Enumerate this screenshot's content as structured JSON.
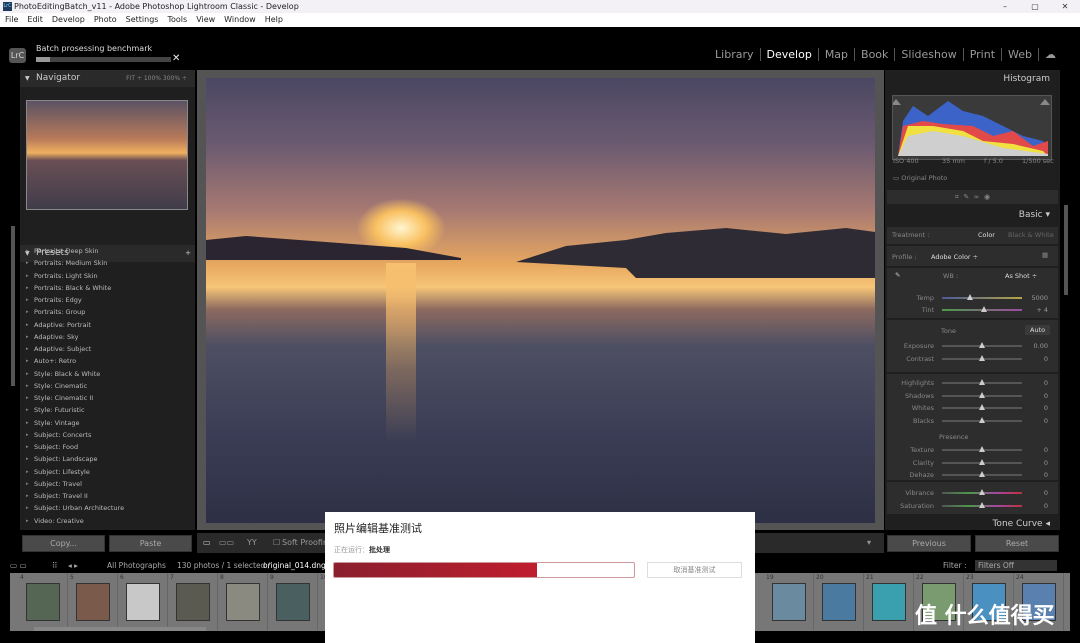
{
  "window": {
    "title": "PhotoEditingBatch_v11 - Adobe Photoshop Lightroom Classic - Develop",
    "logo": "LrC",
    "minimize": "–",
    "maximize": "▢",
    "close": "✕"
  },
  "menu": [
    "File",
    "Edit",
    "Develop",
    "Photo",
    "Settings",
    "Tools",
    "View",
    "Window",
    "Help"
  ],
  "task": {
    "label": "Batch prosessing benchmark",
    "progress": 0.1,
    "close": "✕"
  },
  "modules": [
    {
      "label": "Library",
      "active": false
    },
    {
      "label": "Develop",
      "active": true
    },
    {
      "label": "Map",
      "active": false
    },
    {
      "label": "Book",
      "active": false
    },
    {
      "label": "Slideshow",
      "active": false
    },
    {
      "label": "Print",
      "active": false
    },
    {
      "label": "Web",
      "active": false
    }
  ],
  "navigator": {
    "title": "Navigator",
    "zoom": "FIT  ÷  100%   300%  ÷"
  },
  "presets": {
    "title": "Presets",
    "items": [
      "Portraits: Deep Skin",
      "Portraits: Medium Skin",
      "Portraits: Light Skin",
      "Portraits: Black & White",
      "Portraits: Edgy",
      "Portraits: Group",
      "Adaptive: Portrait",
      "Adaptive: Sky",
      "Adaptive: Subject",
      "Auto+: Retro",
      "Style: Black & White",
      "Style: Cinematic",
      "Style: Cinematic II",
      "Style: Futuristic",
      "Style: Vintage",
      "Subject: Concerts",
      "Subject: Food",
      "Subject: Landscape",
      "Subject: Lifestyle",
      "Subject: Travel",
      "Subject: Travel II",
      "Subject: Urban Architecture",
      "Video: Creative"
    ]
  },
  "left_buttons": {
    "copy": "Copy...",
    "paste": "Paste"
  },
  "toolbar": {
    "soft_proofing": "Soft Proofing"
  },
  "histogram": {
    "title": "Histogram",
    "iso": "ISO 400",
    "focal": "35 mm",
    "aperture": "f / 5.0",
    "shutter": "1/500 sec",
    "original": "Original Photo"
  },
  "basic": {
    "title": "Basic",
    "treatment_label": "Treatment :",
    "color": "Color",
    "bw": "Black & White",
    "profile_label": "Profile :",
    "profile": "Adobe Color ÷",
    "wb_label": "WB :",
    "wb": "As Shot ÷",
    "temp": {
      "label": "Temp",
      "value": "5000",
      "pos": 0.35
    },
    "tint": {
      "label": "Tint",
      "value": "+ 4",
      "pos": 0.52
    },
    "tone_label": "Tone",
    "auto": "Auto",
    "tone": [
      {
        "label": "Exposure",
        "value": "0.00",
        "pos": 0.5
      },
      {
        "label": "Contrast",
        "value": "0",
        "pos": 0.5
      }
    ],
    "tone2": [
      {
        "label": "Highlights",
        "value": "0",
        "pos": 0.5
      },
      {
        "label": "Shadows",
        "value": "0",
        "pos": 0.5
      },
      {
        "label": "Whites",
        "value": "0",
        "pos": 0.5
      },
      {
        "label": "Blacks",
        "value": "0",
        "pos": 0.5
      }
    ],
    "presence_label": "Presence",
    "presence": [
      {
        "label": "Texture",
        "value": "0",
        "pos": 0.5
      },
      {
        "label": "Clarity",
        "value": "0",
        "pos": 0.5
      },
      {
        "label": "Dehaze",
        "value": "0",
        "pos": 0.5
      }
    ],
    "presence2": [
      {
        "label": "Vibrance",
        "value": "0",
        "pos": 0.5
      },
      {
        "label": "Saturation",
        "value": "0",
        "pos": 0.5
      }
    ]
  },
  "tone_curve": "Tone Curve",
  "right_buttons": {
    "previous": "Previous",
    "reset": "Reset"
  },
  "filmstrip": {
    "source": "All Photographs",
    "count": "130 photos / 1 selected /",
    "file": "original_014.dng",
    "filter_label": "Filter :",
    "filter": "Filters Off",
    "left_frames": [
      "4",
      "5",
      "6",
      "7",
      "8",
      "9",
      "10"
    ],
    "right_frames": [
      "19",
      "20",
      "21",
      "22",
      "23",
      "24"
    ]
  },
  "dialog": {
    "title": "照片编辑基准测试",
    "running_label": "正在运行：",
    "running": "批处理",
    "progress": 0.675,
    "cancel": "取消基准测试"
  },
  "watermark": "值 什么值得买"
}
